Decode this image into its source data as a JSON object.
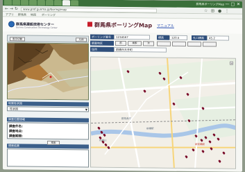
{
  "browser": {
    "window_title": "群馬県ボーリングMap",
    "controls": [
      "—",
      "□",
      "✕"
    ],
    "address": "www.pref.gunma.jp/boring/map",
    "bookmarks": [
      "アプリ",
      "群馬県",
      "地図",
      "ボーリング"
    ],
    "tabs_count": 9
  },
  "header": {
    "org_name": "群馬県建設技術センター",
    "org_sub": "Gunma Construction Technology Center",
    "site_title": "群馬県ボーリングMap",
    "manual_label": "マニュアル"
  },
  "left_panel": {
    "toolbar_buttons": [
      "表示切替",
      "凡例"
    ],
    "select_label": "地質柱状図",
    "select_value": "柱状図",
    "info_head": "調査位置情報",
    "info_rows": [
      "調査件名:",
      "調査地点:",
      "調査期間:"
    ],
    "search_head": "検索結果",
    "search_button": "検索"
  },
  "right_panel": {
    "row1_label": "ボーリング番号",
    "row1_value": "1234567",
    "row1_mid_label": "標高",
    "row1_mid_value": "120.5",
    "row1_right_label": "孔口標高",
    "row1_right_value": "45.2",
    "row2_label": "調査地区",
    "row2_buttons": [
      "前",
      "検索",
      "次"
    ],
    "row3_label": "住所",
    "row3_value": "前橋市大手町"
  },
  "map": {
    "labels": [
      "群馬県庁",
      "前橋駅",
      "利根川",
      "新前橋駅"
    ],
    "zoom_in": "+",
    "pins_count": 28
  },
  "colors": {
    "accent": "#2f4f7c",
    "brand_red": "#c81d2a",
    "pin": "#7a0c2a",
    "terrain": "#8a6b3f"
  }
}
